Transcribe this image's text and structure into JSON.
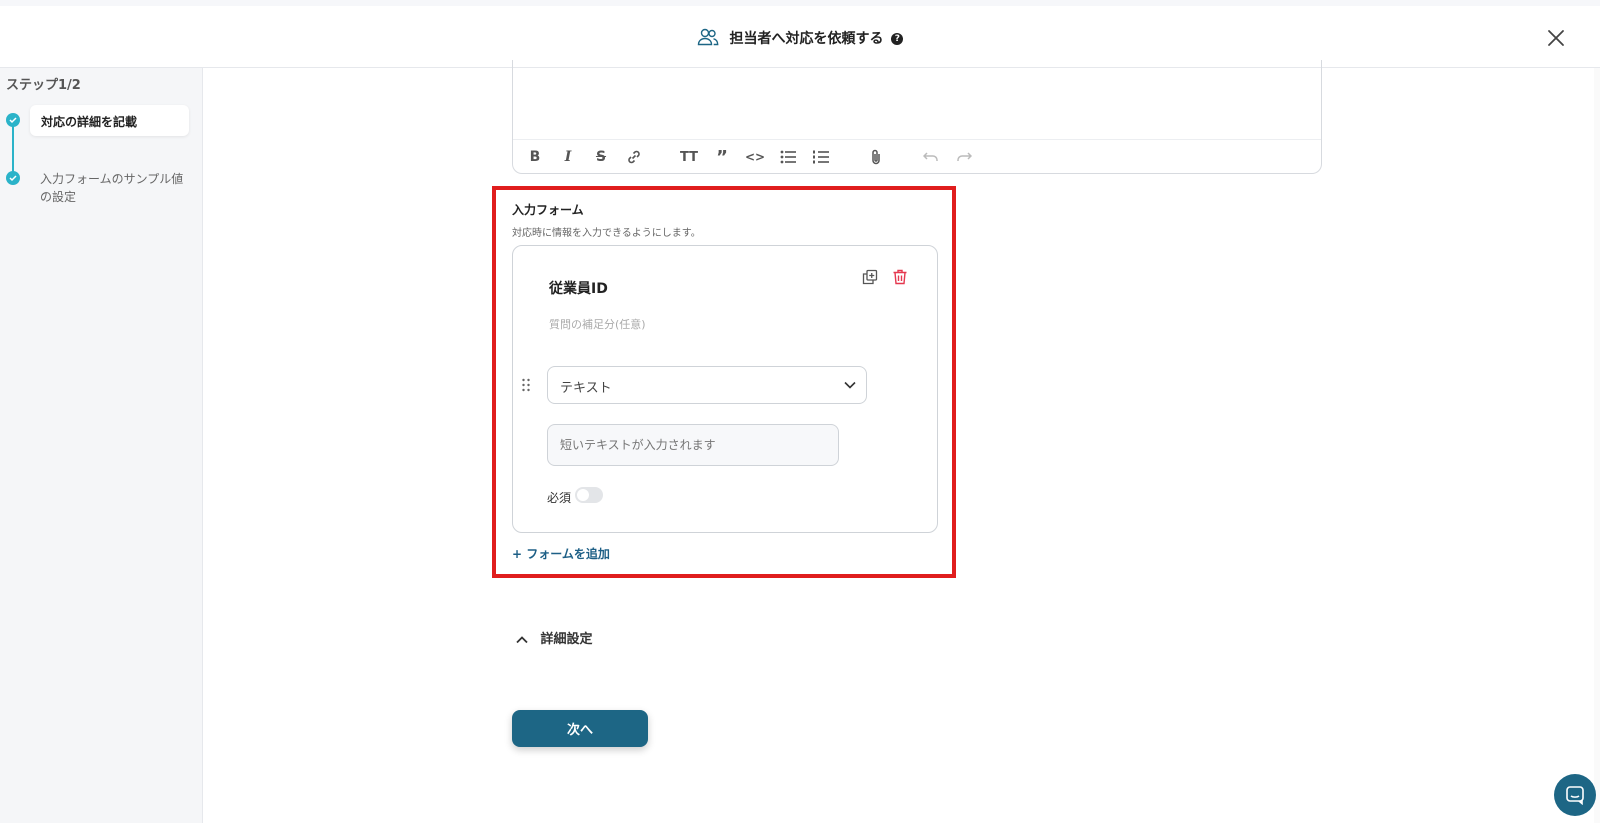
{
  "header": {
    "title": "担当者へ対応を依頼する",
    "help_glyph": "?"
  },
  "sidebar": {
    "step_label": "ステップ1/2",
    "steps": [
      {
        "label": "対応の詳細を記載",
        "active": true
      },
      {
        "label": "入力フォームのサンプル値の設定",
        "active": false
      }
    ]
  },
  "editor": {
    "toolbar": [
      "bold",
      "italic",
      "strikethrough",
      "link",
      "heading",
      "quote",
      "code",
      "bullet-list",
      "numbered-list",
      "attachment",
      "undo",
      "redo"
    ]
  },
  "input_form": {
    "title": "入力フォーム",
    "description": "対応時に情報を入力できるようにします。",
    "question": {
      "title": "従業員ID",
      "supplement_placeholder": "質問の補足分(任意)",
      "type_selected": "テキスト",
      "answer_placeholder": "短いテキストが入力されます",
      "required_label": "必須",
      "required": false
    },
    "add_label": "+ フォームを追加"
  },
  "advanced": {
    "label": "詳細設定"
  },
  "next_button": {
    "label": "次へ"
  },
  "colors": {
    "accent": "#2bb3c9",
    "primary": "#1d6685",
    "link": "#1d5f86",
    "highlight": "#e01d1d",
    "delete": "#e5384f"
  }
}
